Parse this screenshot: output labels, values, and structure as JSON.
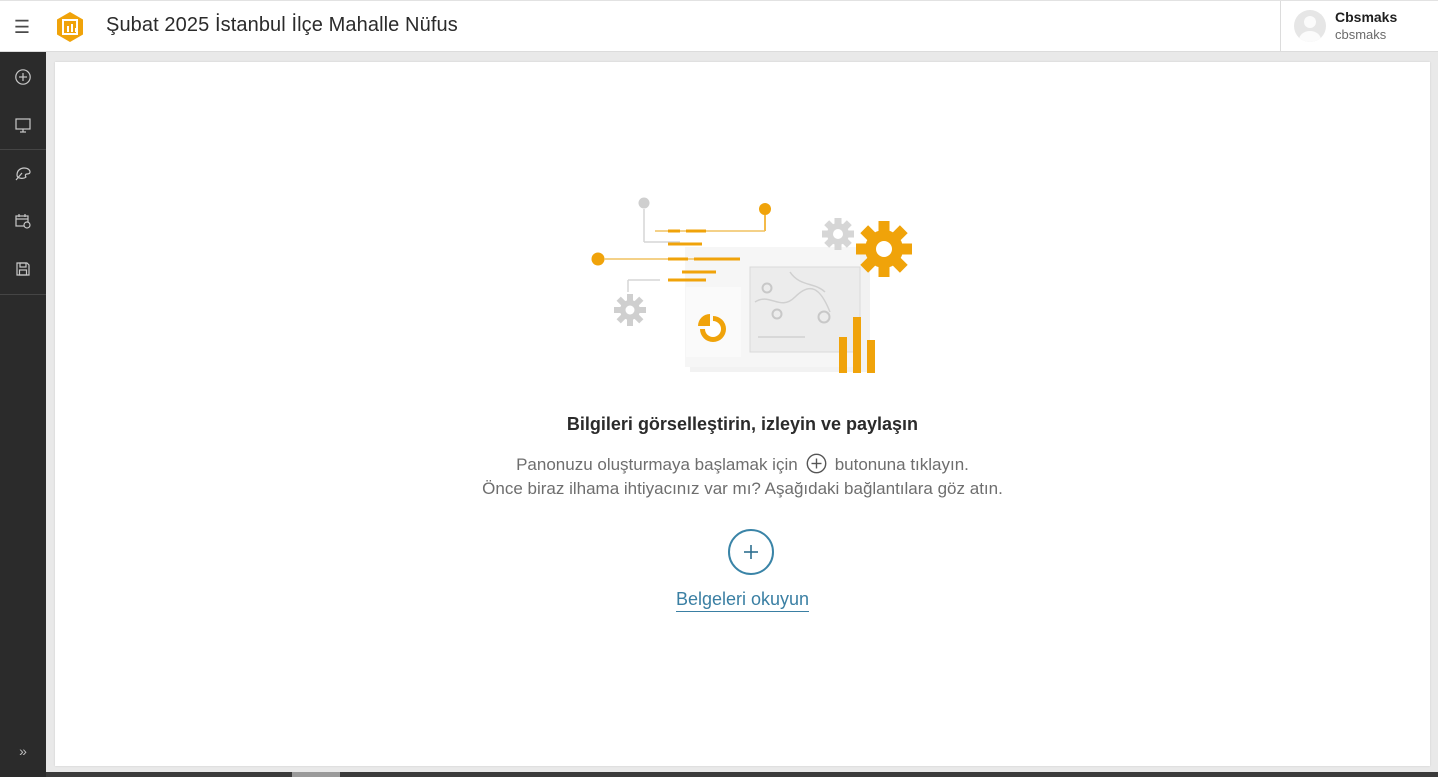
{
  "header": {
    "title": "Şubat 2025 İstanbul İlçe Mahalle Nüfus",
    "menu_icon": "hamburger-menu-icon",
    "logo_icon": "dashboard-app-logo",
    "accent_color": "#f0a30a"
  },
  "user": {
    "name": "Cbsmaks",
    "login": "cbsmaks"
  },
  "sidebar": {
    "items": [
      {
        "id": "add",
        "icon": "add-element-icon"
      },
      {
        "id": "layout",
        "icon": "monitor-icon"
      },
      {
        "id": "theme",
        "icon": "palette-icon"
      },
      {
        "id": "settings",
        "icon": "dashboard-settings-icon"
      },
      {
        "id": "save",
        "icon": "save-icon"
      }
    ],
    "expand_icon": "double-chevron-right-icon",
    "background": "#2b2b2b"
  },
  "empty_state": {
    "heading": "Bilgileri görselleştirin, izleyin ve paylaşın",
    "line1_before": "Panonuzu oluşturmaya başlamak için",
    "line1_after": "butonuna tıklayın.",
    "line2": "Önce biraz ilhama ihtiyacınız var mı? Aşağıdaki bağlantılara göz atın.",
    "docs_link": "Belgeleri okuyun",
    "link_color": "#3a7fa3"
  }
}
